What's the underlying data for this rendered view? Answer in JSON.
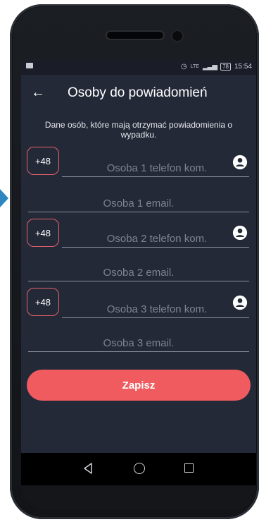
{
  "status_bar": {
    "network": "LTE",
    "battery": "78",
    "time": "15:54"
  },
  "app_bar": {
    "title": "Osoby do powiadomień",
    "back_icon": "arrow-left-icon"
  },
  "description": "Dane osób, które mają otrzymać powiadomienia o wypadku.",
  "contacts": [
    {
      "country_code": "+48",
      "phone_placeholder": "Osoba 1 telefon kom.",
      "email_placeholder": "Osoba 1 email."
    },
    {
      "country_code": "+48",
      "phone_placeholder": "Osoba 2 telefon kom.",
      "email_placeholder": "Osoba 2 email."
    },
    {
      "country_code": "+48",
      "phone_placeholder": "Osoba 3 telefon kom.",
      "email_placeholder": "Osoba 3 email."
    }
  ],
  "save_button": {
    "label": "Zapisz"
  },
  "colors": {
    "background": "#242938",
    "accent": "#ef5b5e",
    "code_border": "#e2616a",
    "placeholder": "#7e8392"
  }
}
